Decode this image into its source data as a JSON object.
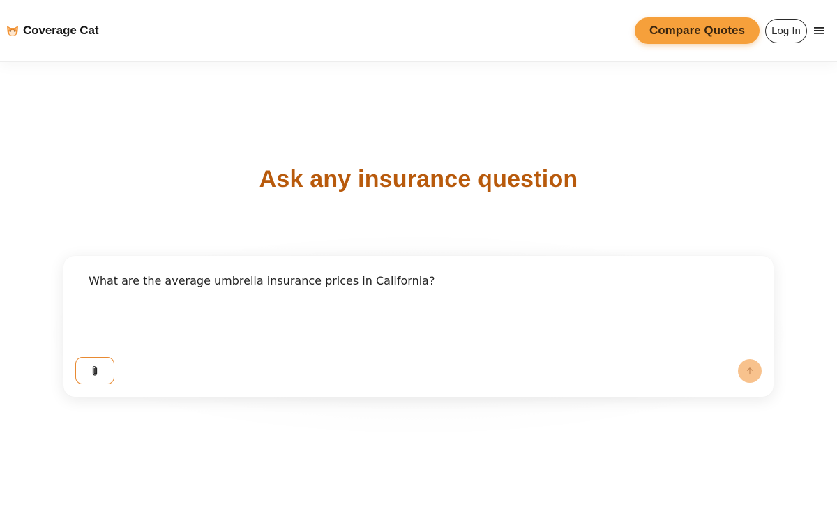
{
  "header": {
    "brand_name": "Coverage Cat",
    "logo_icon": "cat-face-icon",
    "compare_quotes_label": "Compare Quotes",
    "login_label": "Log In",
    "menu_icon": "hamburger-menu-icon"
  },
  "main": {
    "heading": "Ask any insurance question",
    "chat_input": {
      "value": "What are the average umbrella insurance prices in California?",
      "attach_icon": "paperclip-icon",
      "send_icon": "arrow-up-icon"
    }
  },
  "colors": {
    "accent": "#f6a03b",
    "heading": "#b85a0c",
    "send_button": "#f8c28d",
    "attach_border": "#e88a32"
  }
}
